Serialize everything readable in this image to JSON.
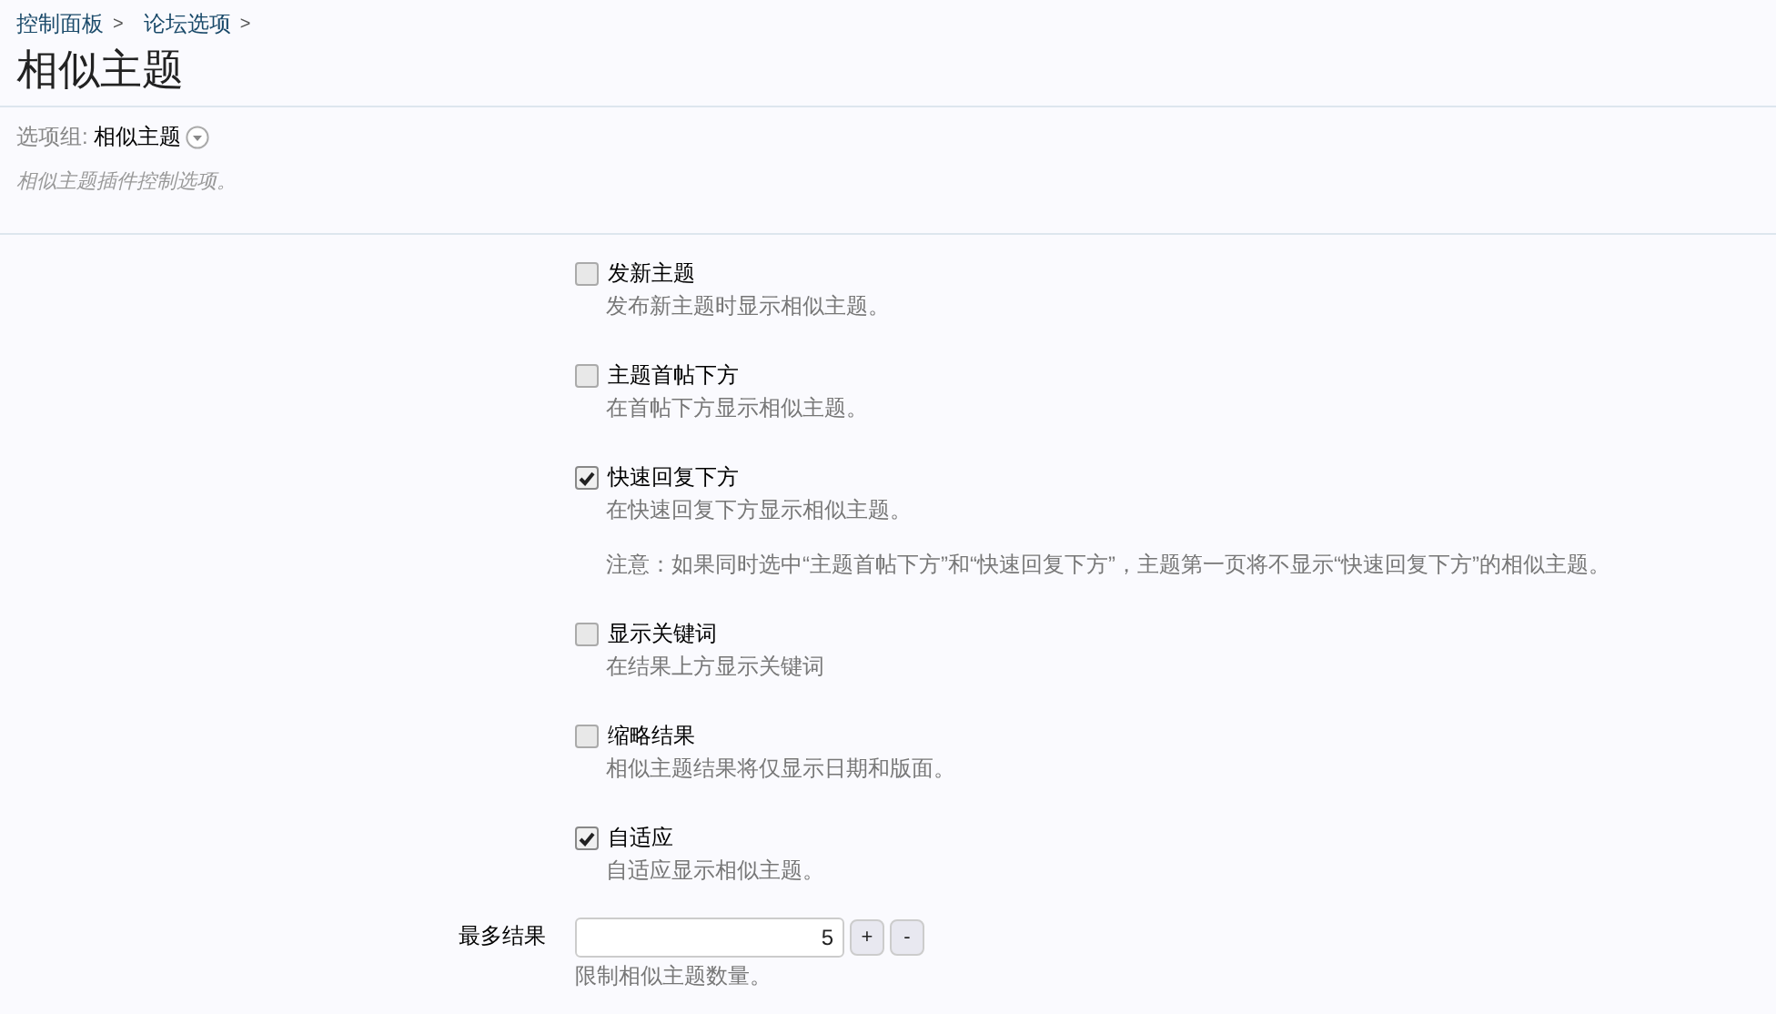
{
  "breadcrumb": [
    {
      "label": "控制面板",
      "separator": ">"
    },
    {
      "label": "论坛选项",
      "separator": ">"
    }
  ],
  "title": "相似主题",
  "option_group": {
    "label": "选项组:",
    "value": "相似主题"
  },
  "description": "相似主题插件控制选项。",
  "options": [
    {
      "label": "发新主题",
      "checked": false,
      "hint": "发布新主题时显示相似主题。"
    },
    {
      "label": "主题首帖下方",
      "checked": false,
      "hint": "在首帖下方显示相似主题。"
    },
    {
      "label": "快速回复下方",
      "checked": true,
      "hint": "在快速回复下方显示相似主题。",
      "note": "注意：如果同时选中“主题首帖下方”和“快速回复下方”，主题第一页将不显示“快速回复下方”的相似主题。"
    },
    {
      "label": "显示关键词",
      "checked": false,
      "hint": "在结果上方显示关键词"
    },
    {
      "label": "缩略结果",
      "checked": false,
      "hint": "相似主题结果将仅显示日期和版面。"
    },
    {
      "label": "自适应",
      "checked": true,
      "hint": "自适应显示相似主题。"
    }
  ],
  "max_results": {
    "label": "最多结果",
    "value": "5",
    "increment": "+",
    "decrement": "-",
    "hint": "限制相似主题数量。"
  }
}
